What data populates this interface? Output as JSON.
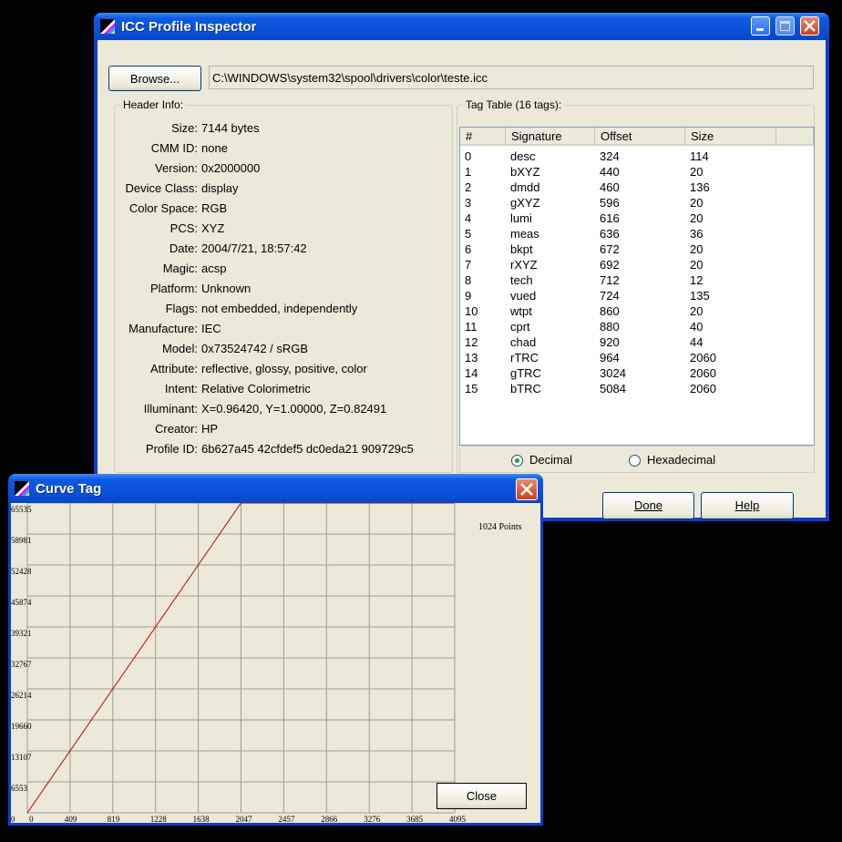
{
  "main_window": {
    "title": "ICC Profile Inspector",
    "browse_label": "Browse...",
    "path": "C:\\WINDOWS\\system32\\spool\\drivers\\color\\teste.icc",
    "header_group_label": "Header Info:",
    "header_fields": [
      {
        "label": "Size:",
        "value": "7144 bytes"
      },
      {
        "label": "CMM ID:",
        "value": "none"
      },
      {
        "label": "Version:",
        "value": "0x2000000"
      },
      {
        "label": "Device Class:",
        "value": "display"
      },
      {
        "label": "Color Space:",
        "value": "RGB"
      },
      {
        "label": "PCS:",
        "value": "XYZ"
      },
      {
        "label": "Date:",
        "value": "2004/7/21, 18:57:42"
      },
      {
        "label": "Magic:",
        "value": "acsp"
      },
      {
        "label": "Platform:",
        "value": "Unknown"
      },
      {
        "label": "Flags:",
        "value": "not embedded, independently"
      },
      {
        "label": "Manufacture:",
        "value": "IEC"
      },
      {
        "label": "Model:",
        "value": "0x73524742 / sRGB"
      },
      {
        "label": "Attribute:",
        "value": "reflective, glossy, positive, color"
      },
      {
        "label": "Intent:",
        "value": "Relative Colorimetric"
      },
      {
        "label": "Illuminant:",
        "value": "X=0.96420, Y=1.00000, Z=0.82491"
      },
      {
        "label": "Creator:",
        "value": "HP"
      },
      {
        "label": "Profile ID:",
        "value": "6b627a45 42cfdef5 dc0eda21 909729c5"
      }
    ],
    "tag_group_label": "Tag Table (16 tags):",
    "tag_columns": [
      "#",
      "Signature",
      "Offset",
      "Size"
    ],
    "tags": [
      [
        "0",
        "desc",
        "324",
        "114"
      ],
      [
        "1",
        "bXYZ",
        "440",
        "20"
      ],
      [
        "2",
        "dmdd",
        "460",
        "136"
      ],
      [
        "3",
        "gXYZ",
        "596",
        "20"
      ],
      [
        "4",
        "lumi",
        "616",
        "20"
      ],
      [
        "5",
        "meas",
        "636",
        "36"
      ],
      [
        "6",
        "bkpt",
        "672",
        "20"
      ],
      [
        "7",
        "rXYZ",
        "692",
        "20"
      ],
      [
        "8",
        "tech",
        "712",
        "12"
      ],
      [
        "9",
        "vued",
        "724",
        "135"
      ],
      [
        "10",
        "wtpt",
        "860",
        "20"
      ],
      [
        "11",
        "cprt",
        "880",
        "40"
      ],
      [
        "12",
        "chad",
        "920",
        "44"
      ],
      [
        "13",
        "rTRC",
        "964",
        "2060"
      ],
      [
        "14",
        "gTRC",
        "3024",
        "2060"
      ],
      [
        "15",
        "bTRC",
        "5084",
        "2060"
      ]
    ],
    "radio_decimal": "Decimal",
    "radio_hex": "Hexadecimal",
    "selected_format": "Decimal",
    "done_label": "Done",
    "help_label": "Help"
  },
  "curve_window": {
    "title": "Curve Tag",
    "points_label": "1024 Points",
    "close_label": "Close"
  },
  "chart_data": {
    "type": "line",
    "x_ticks": [
      "0",
      "409",
      "819",
      "1228",
      "1638",
      "2047",
      "2457",
      "2866",
      "3276",
      "3685",
      "4095"
    ],
    "y_ticks": [
      "0",
      "6553",
      "13107",
      "19660",
      "26214",
      "32767",
      "39321",
      "45874",
      "52428",
      "58981",
      "65535"
    ],
    "xlim": [
      0,
      4095
    ],
    "ylim": [
      0,
      65535
    ],
    "grid": true,
    "series": [
      {
        "color": "#cc0000",
        "x": [
          0,
          2047,
          4095
        ],
        "y": [
          0,
          65535,
          65535
        ]
      }
    ]
  }
}
